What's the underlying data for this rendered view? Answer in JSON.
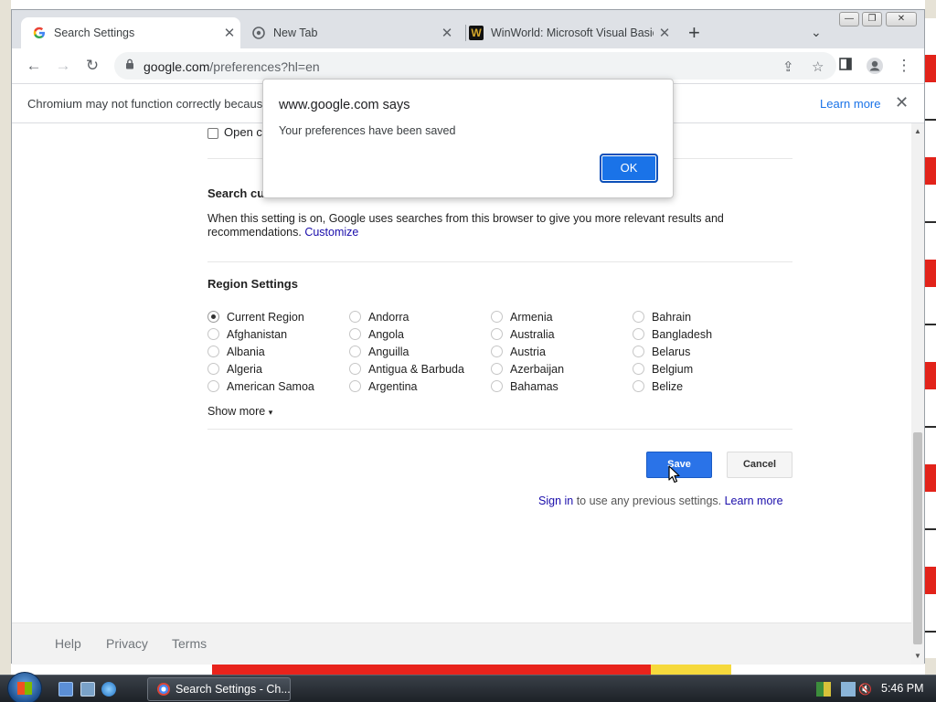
{
  "tabs": [
    {
      "label": "Search Settings",
      "icon": "google-g-icon",
      "active": true
    },
    {
      "label": "New Tab",
      "icon": "chrome-icon",
      "active": false
    },
    {
      "label": "WinWorld: Microsoft Visual Basic",
      "icon": "winworld-icon",
      "active": false
    }
  ],
  "toolbar": {
    "url_host": "google.com",
    "url_path": "/preferences?hl=en"
  },
  "infobar": {
    "message": "Chromium may not function correctly becaus",
    "learn_more": "Learn more"
  },
  "page": {
    "open_label": "Open c",
    "search_section_title": "Search cu",
    "search_desc": "When this setting is on, Google uses searches from this browser to give you more relevant results and recommendations.",
    "customize": "Customize",
    "region_title": "Region Settings",
    "regions": [
      [
        "Current Region",
        "Afghanistan",
        "Albania",
        "Algeria",
        "American Samoa"
      ],
      [
        "Andorra",
        "Angola",
        "Anguilla",
        "Antigua & Barbuda",
        "Argentina"
      ],
      [
        "Armenia",
        "Australia",
        "Austria",
        "Azerbaijan",
        "Bahamas"
      ],
      [
        "Bahrain",
        "Bangladesh",
        "Belarus",
        "Belgium",
        "Belize"
      ]
    ],
    "selected_region": "Current Region",
    "show_more": "Show more",
    "save": "Save",
    "cancel": "Cancel",
    "sign_in": "Sign in",
    "sign_in_rest": " to use any previous settings. ",
    "learn_more": "Learn more"
  },
  "footer": {
    "help": "Help",
    "privacy": "Privacy",
    "terms": "Terms"
  },
  "dialog": {
    "title": "www.google.com says",
    "message": "Your preferences have been saved",
    "ok": "OK"
  },
  "taskbar": {
    "task_label": "Search Settings - Ch...",
    "clock": "5:46 PM"
  },
  "colors": {
    "accent": "#1a73e8",
    "link": "#1a0dab"
  }
}
